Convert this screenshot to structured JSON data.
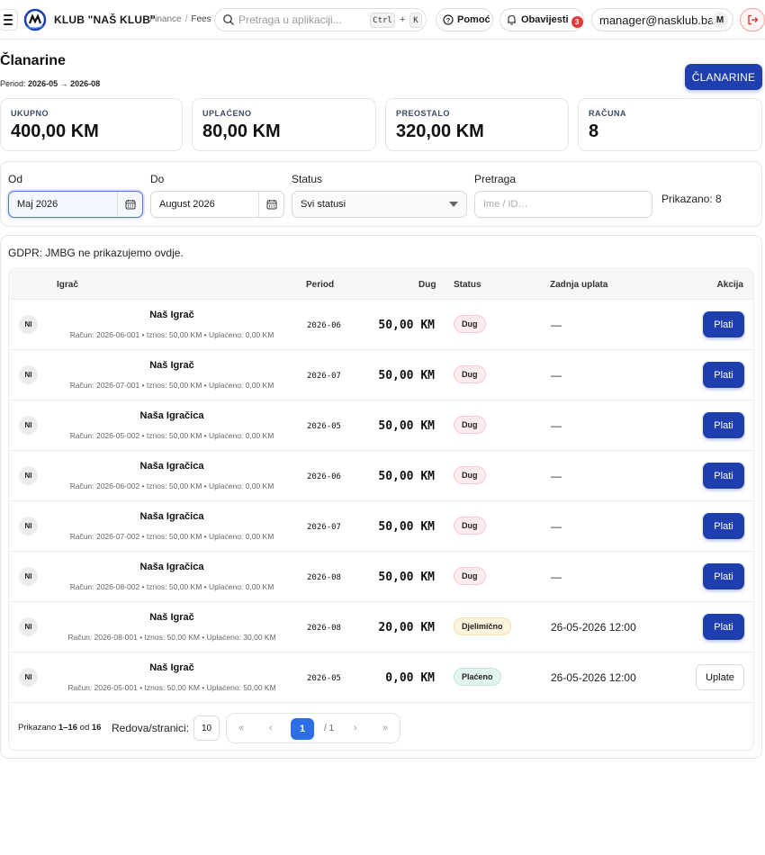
{
  "topbar": {
    "brand": "KLUB \"NAŠ KLUB\"",
    "breadcrumbs": [
      "Finance",
      "Fees"
    ],
    "search_placeholder": "Pretraga u aplikaciji...",
    "shortcut": [
      "Ctrl",
      "+",
      "K"
    ],
    "help_label": "Pomoć",
    "notifications_label": "Obavijesti",
    "notifications_count": "3",
    "user_email": "manager@nasklub.ba",
    "user_initial": "M"
  },
  "header": {
    "title": "Članarine",
    "period_prefix": "Period:",
    "period_range": "2026-05 → 2026-08",
    "action_label": "ČLANARINE"
  },
  "stats": [
    {
      "label": "UKUPNO",
      "value": "400,00 KM"
    },
    {
      "label": "UPLAĆENO",
      "value": "80,00 KM"
    },
    {
      "label": "PREOSTALO",
      "value": "320,00 KM"
    },
    {
      "label": "RAČUNA",
      "value": "8"
    }
  ],
  "filters": {
    "from_label": "Od",
    "from_value": "Maj 2026",
    "to_label": "Do",
    "to_value": "August 2026",
    "status_label": "Status",
    "status_value": "Svi statusi",
    "search_label": "Pretraga",
    "search_placeholder": "Ime / ID…",
    "shown_text": "Prikazano: 8"
  },
  "table": {
    "note": "GDPR: JMBG ne prikazujemo ovdje.",
    "columns": [
      "Igrač",
      "Period",
      "Dug",
      "Status",
      "Zadnja uplata",
      "Akcija"
    ],
    "rows": [
      {
        "initials": "NI",
        "name": "Naš Igrač",
        "sub": "Račun: 2026-06-001 • Iznos: 50,00 KM • Uplaćeno: 0,00 KM",
        "period": "2026-06",
        "debt": "50,00 KM",
        "status": "Dug",
        "last_payment": "—",
        "action": "Plati"
      },
      {
        "initials": "NI",
        "name": "Naš Igrač",
        "sub": "Račun: 2026-07-001 • Iznos: 50,00 KM • Uplaćeno: 0,00 KM",
        "period": "2026-07",
        "debt": "50,00 KM",
        "status": "Dug",
        "last_payment": "—",
        "action": "Plati"
      },
      {
        "initials": "NI",
        "name": "Naša Igračica",
        "sub": "Račun: 2026-05-002 • Iznos: 50,00 KM • Uplaćeno: 0,00 KM",
        "period": "2026-05",
        "debt": "50,00 KM",
        "status": "Dug",
        "last_payment": "—",
        "action": "Plati"
      },
      {
        "initials": "NI",
        "name": "Naša Igračica",
        "sub": "Račun: 2026-06-002 • Iznos: 50,00 KM • Uplaćeno: 0,00 KM",
        "period": "2026-06",
        "debt": "50,00 KM",
        "status": "Dug",
        "last_payment": "—",
        "action": "Plati"
      },
      {
        "initials": "NI",
        "name": "Naša Igračica",
        "sub": "Račun: 2026-07-002 • Iznos: 50,00 KM • Uplaćeno: 0,00 KM",
        "period": "2026-07",
        "debt": "50,00 KM",
        "status": "Dug",
        "last_payment": "—",
        "action": "Plati"
      },
      {
        "initials": "NI",
        "name": "Naša Igračica",
        "sub": "Račun: 2026-08-002 • Iznos: 50,00 KM • Uplaćeno: 0,00 KM",
        "period": "2026-08",
        "debt": "50,00 KM",
        "status": "Dug",
        "last_payment": "—",
        "action": "Plati"
      },
      {
        "initials": "NI",
        "name": "Naš Igrač",
        "sub": "Račun: 2026-08-001 • Iznos: 50,00 KM • Uplaćeno: 30,00 KM",
        "period": "2026-08",
        "debt": "20,00 KM",
        "status": "Djelimično",
        "last_payment": "26-05-2026 12:00",
        "action": "Plati"
      },
      {
        "initials": "NI",
        "name": "Naš Igrač",
        "sub": "Račun: 2026-05-001 • Iznos: 50,00 KM • Uplaćeno: 50,00 KM",
        "period": "2026-05",
        "debt": "0,00 KM",
        "status": "Plaćeno",
        "last_payment": "26-05-2026 12:00",
        "action": "Uplate"
      }
    ]
  },
  "pagination": {
    "info_prefix": "Prikazano",
    "info_range": "1–16",
    "info_of": "od",
    "info_total": "16",
    "rows_per_page_label": "Redova/stranici:",
    "rows_per_page": "10",
    "first": "«",
    "prev": "‹",
    "current": "1",
    "of_pages": "/ 1",
    "next": "›",
    "last": "»"
  },
  "colors": {
    "primary": "#1f3fae",
    "page_active": "#2d6ee6",
    "badge": "#e53935"
  }
}
